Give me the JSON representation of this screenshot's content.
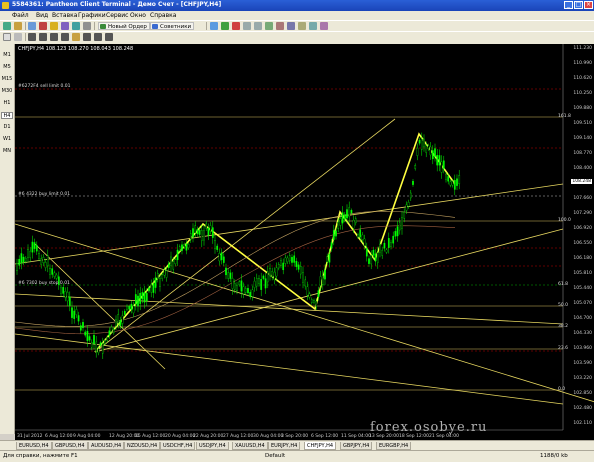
{
  "window": {
    "title": "5584361: Pantheon Client Terminal - Демо Счет - [CHFJPY,H4]",
    "buttons": [
      "_",
      "□",
      "×"
    ]
  },
  "menu": [
    "Файл",
    "Вид",
    "Вставка",
    "Графики",
    "Сервис",
    "Окно",
    "Справка"
  ],
  "toolbar": {
    "new_order": "Новый Ордер",
    "advisors": "Советники"
  },
  "timeframes": [
    "M1",
    "M5",
    "M15",
    "M30",
    "H1",
    "H4",
    "D1",
    "W1",
    "MN"
  ],
  "active_timeframe": "H4",
  "chart": {
    "info": "CHFJPY,H4  108.123 108.270 108.043 108.248",
    "levels": [
      {
        "label": "#6272F4 sell limit 0.01",
        "price": "109.802"
      },
      {
        "label": "#6 4322 buy limit 0.01",
        "price": "108.034"
      },
      {
        "label": "#6 7302 buy stop 0.01",
        "price": "105.883"
      }
    ],
    "fib_labels": [
      "161.8",
      "100.0",
      "61.8",
      "50.0",
      "38.2",
      "23.6",
      "0.0"
    ],
    "price_axis": [
      "111.230",
      "110.990",
      "110.620",
      "110.250",
      "109.880",
      "109.510",
      "109.140",
      "108.770",
      "108.400",
      "108.000",
      "107.660",
      "107.290",
      "106.920",
      "106.550",
      "106.180",
      "105.810",
      "105.440",
      "105.070",
      "104.700",
      "104.330",
      "103.960",
      "103.590",
      "103.220",
      "102.850",
      "102.480",
      "102.110"
    ],
    "current_price": "108.248",
    "date_axis": [
      "31 Jul 2012",
      "6 Aug 12:00",
      "9 Aug 04:00",
      "12 Aug 20:00",
      "15 Aug 12:00",
      "20 Aug 04:00",
      "22 Aug 20:00",
      "27 Aug 12:00",
      "30 Aug 04:00",
      "3 Sep 20:00",
      "6 Sep 12:00",
      "11 Sep 04:00",
      "13 Sep 20:00",
      "18 Sep 12:00",
      "21 Sep 04:00"
    ]
  },
  "tabs": [
    "EURUSD,H4",
    "GBPUSD,H4",
    "AUDUSD,H4",
    "NZDUSD,H4",
    "USDCHF,H4",
    "USDJPY,H4",
    "XAUUSD,H4",
    "EURJPY,H4",
    "CHFJPY,H4",
    "GBPJPY,H4",
    "EURGBP,H4"
  ],
  "active_tab": "CHFJPY,H4",
  "status": {
    "help": "Для справки, нажмите F1",
    "profile": "Default",
    "traffic": "1188/0 kb"
  },
  "watermark": "forex.osobye.ru",
  "colors": {
    "chart_bg": "#000000",
    "candles": "#00ff00",
    "trend_lines": "#f0e060",
    "levels_red": "#c00000",
    "levels_green": "#00b000"
  }
}
